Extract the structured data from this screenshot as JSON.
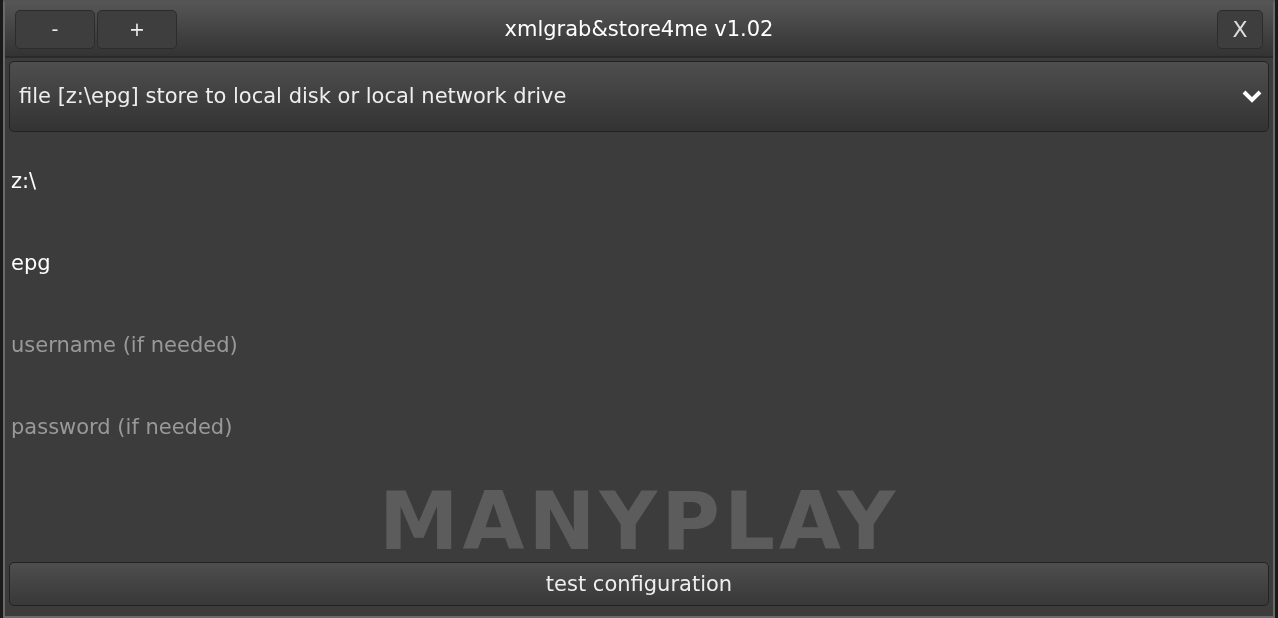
{
  "window": {
    "title": "xmlgrab&store4me v1.02",
    "buttons": [
      "-",
      "+"
    ],
    "close": "X"
  },
  "dropdown": {
    "value": "file [z:\\epg] store to local disk or local network drive"
  },
  "fields": [
    {
      "value": "z:\\"
    },
    {
      "value": "epg"
    },
    {
      "placeholder": "username (if needed)"
    },
    {
      "placeholder": "password (if needed)"
    }
  ],
  "background_logo": "MANYPLAY",
  "buttons": [
    "test configuration"
  ]
}
